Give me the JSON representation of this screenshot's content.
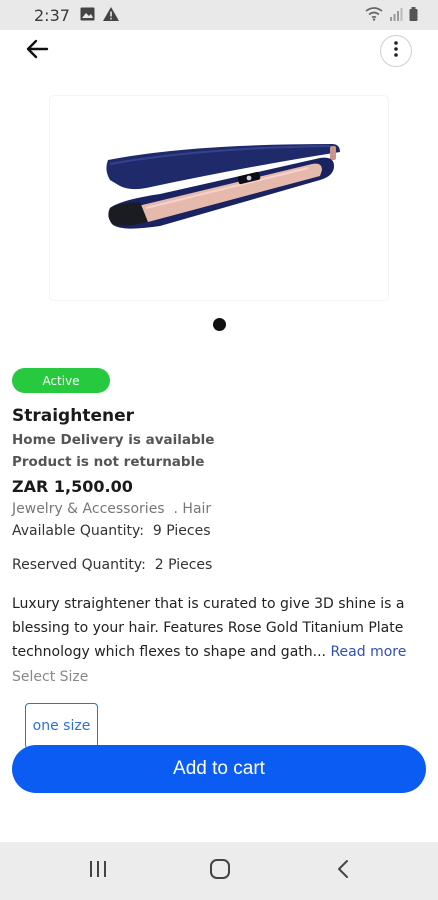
{
  "status_bar": {
    "time": "2:37",
    "icons": [
      "image-icon",
      "warning-icon",
      "wifi-icon",
      "signal-icon",
      "battery-icon"
    ]
  },
  "header": {
    "back_icon": "arrow-left-icon",
    "more_icon": "more-vertical-icon"
  },
  "product": {
    "image_alt": "hair straightener",
    "status": "Active",
    "title": "Straightener",
    "delivery": "Home Delivery is available",
    "returnable": "Product is not returnable",
    "price": "ZAR 1,500.00",
    "category": "Jewelry & Accessories",
    "subcategory": ". Hair",
    "available_label": "Available Quantity:",
    "available_value": "9 Pieces",
    "reserved_label": "Reserved Quantity:",
    "reserved_value": "2 Pieces",
    "description": "Luxury straightener that is curated to give 3D shine is a blessing to your hair. Features Rose Gold Titanium Plate technology which flexes to shape and gath...",
    "read_more": "Read more",
    "select_size_label": "Select Size",
    "sizes": [
      "one size"
    ]
  },
  "actions": {
    "add_to_cart": "Add to cart"
  },
  "carousel": {
    "count": 1,
    "active": 0
  },
  "colors": {
    "primary": "#0a5cf2",
    "active_badge": "#27c93f",
    "link": "#2f4fb5"
  },
  "nav_bar": {
    "icons": [
      "recents-icon",
      "home-icon",
      "back-nav-icon"
    ]
  }
}
